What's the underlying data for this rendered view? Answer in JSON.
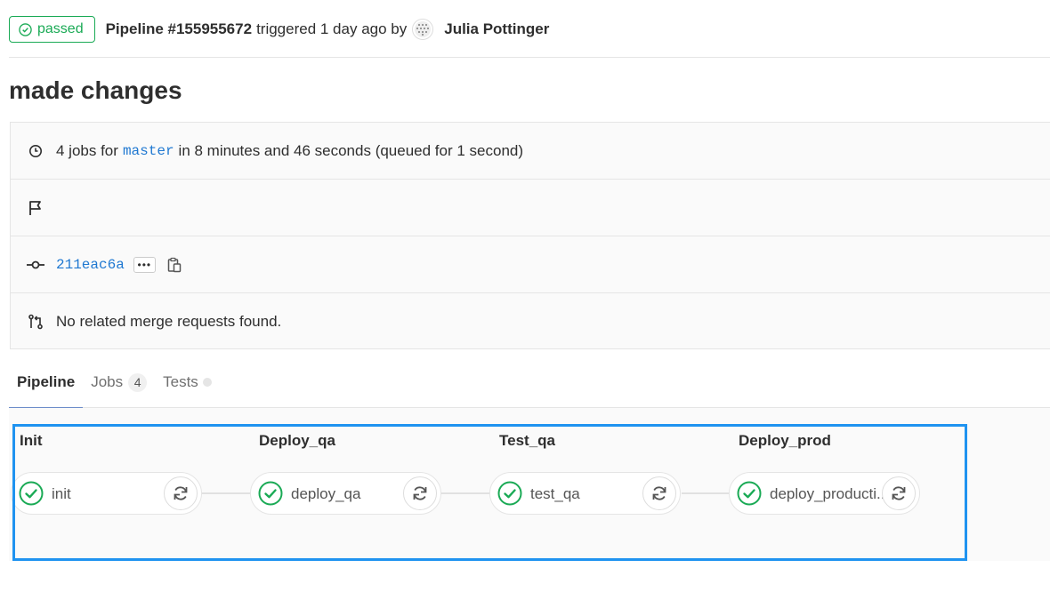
{
  "header": {
    "status": "passed",
    "pipeline": "Pipeline #155955672",
    "triggered": "triggered 1 day ago by",
    "author": "Julia Pottinger"
  },
  "commit_title": "made changes",
  "info": {
    "jobs_prefix": "4 jobs for",
    "branch": "master",
    "duration": "in 8 minutes and 46 seconds (queued for 1 second)",
    "sha": "211eac6a",
    "ellipsis": "•••",
    "merge_requests": "No related merge requests found."
  },
  "tabs": [
    {
      "label": "Pipeline",
      "active": true
    },
    {
      "label": "Jobs",
      "count": "4"
    },
    {
      "label": "Tests"
    }
  ],
  "stages": [
    {
      "title": "Init",
      "job": "init"
    },
    {
      "title": "Deploy_qa",
      "job": "deploy_qa"
    },
    {
      "title": "Test_qa",
      "job": "test_qa"
    },
    {
      "title": "Deploy_prod",
      "job": "deploy_producti..."
    }
  ],
  "colors": {
    "success": "#1aaa55",
    "link": "#1f78d1",
    "highlight": "#1f93f0"
  }
}
